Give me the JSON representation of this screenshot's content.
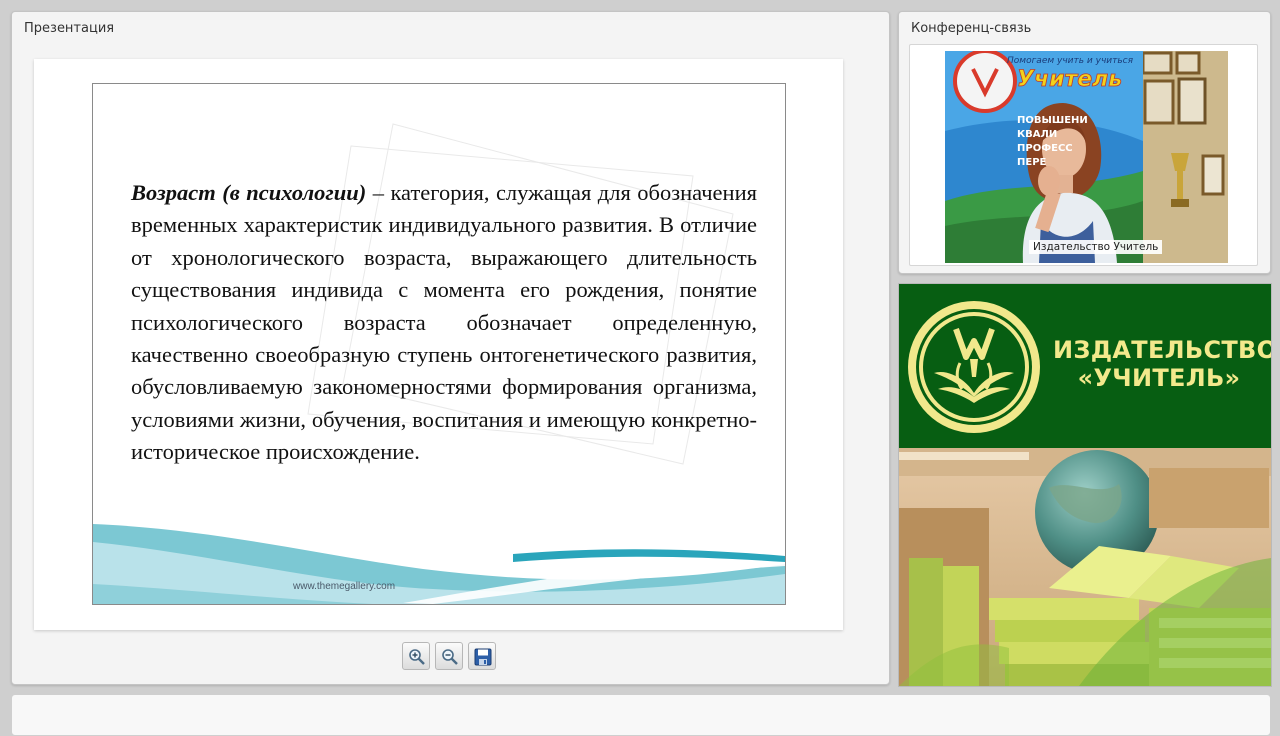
{
  "presentation": {
    "title": "Презентация",
    "slide": {
      "term": "Возраст (в психологии)",
      "body": " – категория, служащая для обозначения временных характеристик индивидуального развития. В отличие от хронологического возраста, выражающего длительность существования индивида с момента его рождения, понятие психологического возраста обозначает определенную, качественно своеобразную ступень онтогенетического развития, обусловливаемую закономерностями формирования организма, условиями жизни, обучения, воспитания и имеющую конкретно-историческое происхождение.",
      "footer_url": "www.themegallery.com"
    },
    "toolbar": {
      "zoom_in": "zoom-in-icon",
      "zoom_out": "zoom-out-icon",
      "save": "save-icon"
    }
  },
  "conference": {
    "title": "Конференц-связь",
    "participant_label": "Издательство Учитель",
    "poster_headline": "Помогаем учить и учиться",
    "poster_brand": "Учитель",
    "poster_lines": [
      "ПОВЫШЕНИ",
      "КВАЛИ",
      "ПРОФЕСС",
      "ПЕРЕ"
    ]
  },
  "banner": {
    "brand_line1": "ИЗДАТЕЛЬСТВО",
    "brand_line2": "«УЧИТЕЛЬ»",
    "colors": {
      "green": "#075e12",
      "gold": "#f3e98c"
    }
  }
}
